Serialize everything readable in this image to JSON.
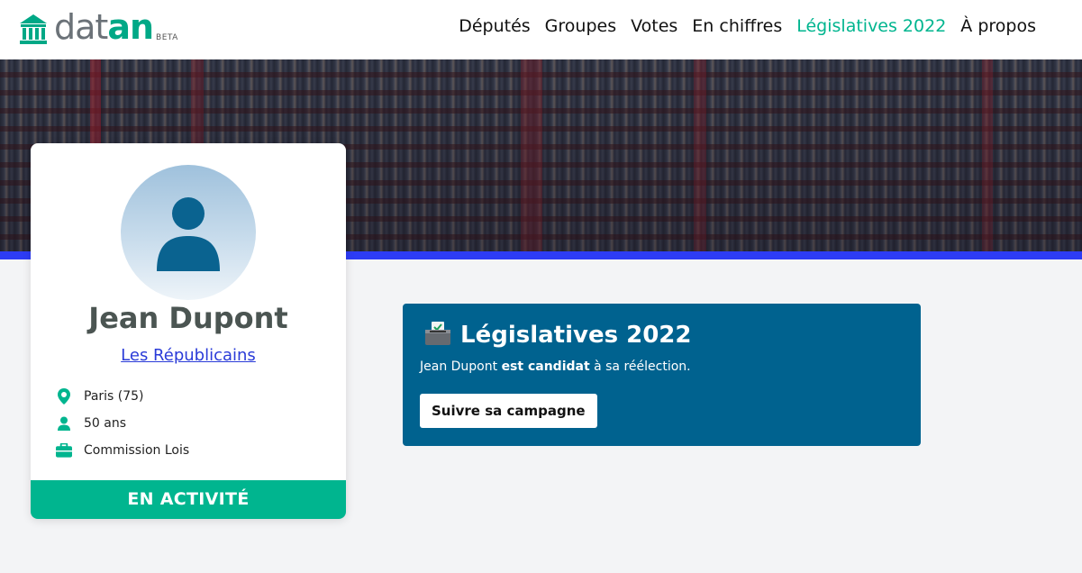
{
  "header": {
    "logo": {
      "dat": "dat",
      "an": "an",
      "beta": "BETA"
    },
    "nav": [
      {
        "label": "Députés",
        "active": false
      },
      {
        "label": "Groupes",
        "active": false
      },
      {
        "label": "Votes",
        "active": false
      },
      {
        "label": "En chiffres",
        "active": false
      },
      {
        "label": "Législatives 2022",
        "active": true
      },
      {
        "label": "À propos",
        "active": false
      }
    ]
  },
  "colors": {
    "accent": "#00b58f",
    "banner_bar": "#2d3cf5",
    "legislatives_bg": "#00628f",
    "link": "#2a3bd8"
  },
  "deputy": {
    "name": "Jean Dupont",
    "group": "Les Républicains",
    "info": {
      "location": "Paris (75)",
      "age": "50 ans",
      "commission": "Commission Lois"
    },
    "icons": {
      "location": "map-pin-icon",
      "age": "person-icon",
      "commission": "briefcase-icon"
    },
    "status": "EN ACTIVITÉ"
  },
  "legislatives": {
    "title": "Législatives 2022",
    "text_before": "Jean Dupont ",
    "text_bold": "est candidat",
    "text_after": " à sa réélection.",
    "button": "Suivre sa campagne",
    "icon": "ballot-box-icon"
  }
}
